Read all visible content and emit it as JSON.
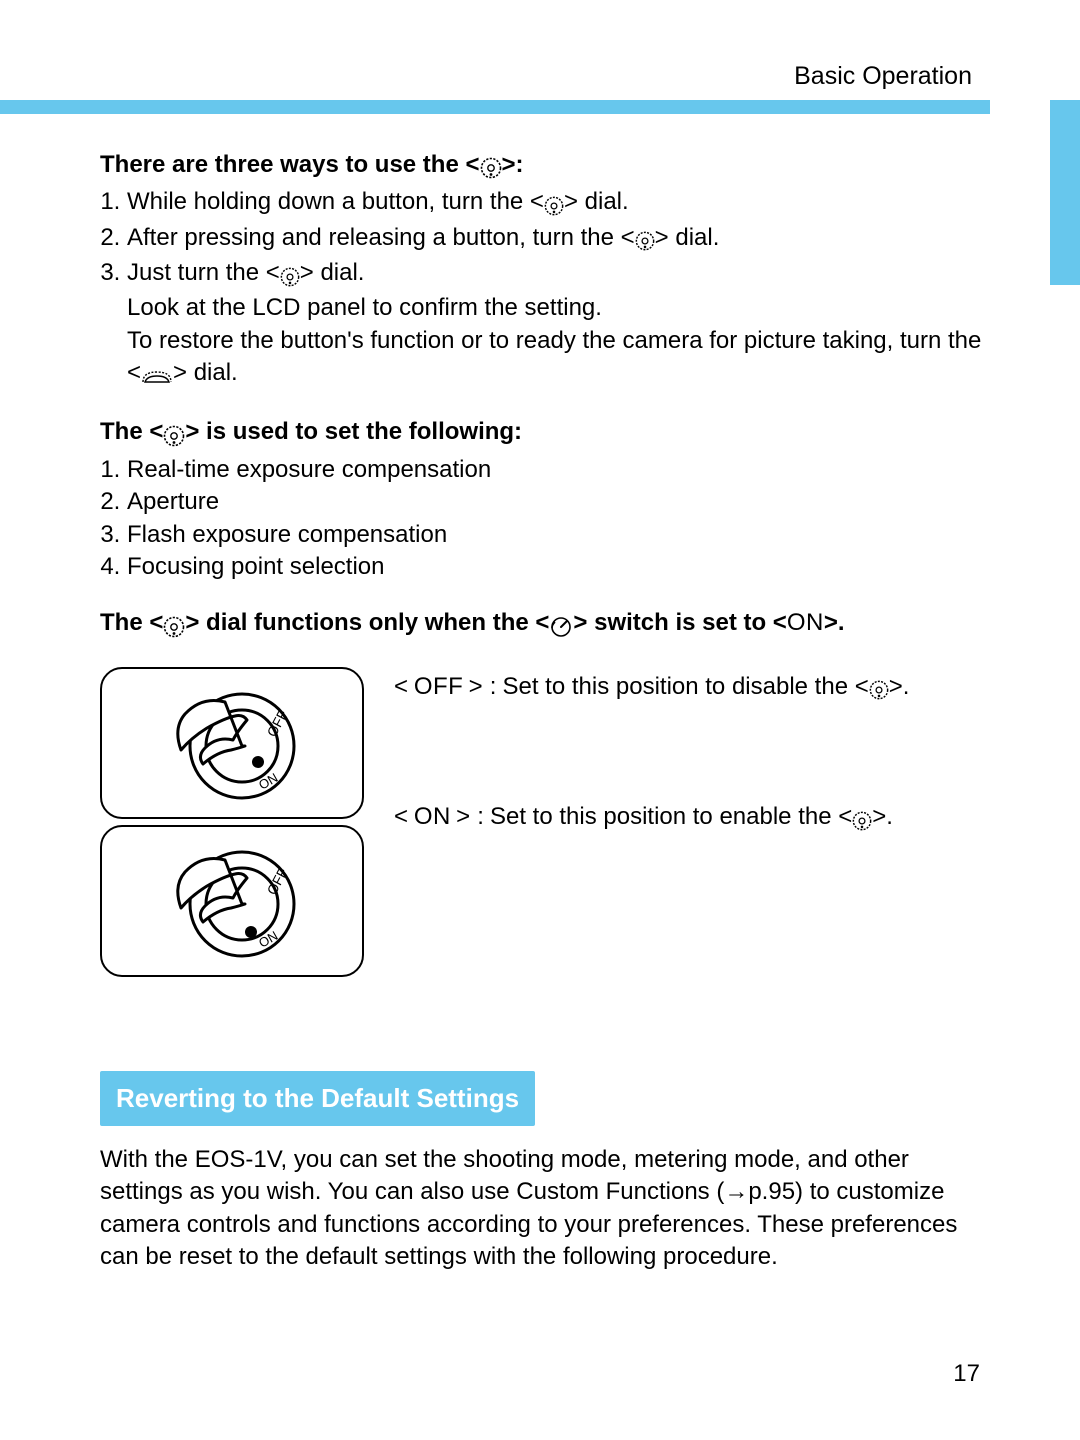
{
  "header": {
    "title": "Basic Operation"
  },
  "section1": {
    "heading_prefix": "There are three ways to use the <",
    "heading_suffix": ">:",
    "items": [
      {
        "prefix": "While holding down a button, turn the <",
        "suffix": "> dial."
      },
      {
        "prefix": "After pressing and releasing a button, turn the <",
        "suffix": "> dial."
      },
      {
        "prefix": "Just turn the <",
        "suffix": "> dial."
      }
    ],
    "note1": "Look at the LCD panel to confirm the setting.",
    "note2_prefix": "To restore the button's function or to ready the camera for picture taking, turn the <",
    "note2_suffix": "> dial."
  },
  "section2": {
    "heading_prefix": "The <",
    "heading_suffix": "> is used to set the following:",
    "items": [
      "Real-time exposure compensation",
      "Aperture",
      "Flash exposure compensation",
      "Focusing point selection"
    ]
  },
  "section3": {
    "heading_p1": "The <",
    "heading_p2": "> dial functions only when the <",
    "heading_p3": "> switch is set to <",
    "heading_on": "ON",
    "heading_p4": ">."
  },
  "switch": {
    "off_label": "OFF",
    "on_label": "ON",
    "off_desc_label": "< OFF >",
    "on_desc_label": "< ON >",
    "colon": " : ",
    "off_text_prefix": "Set to this position to disable the <",
    "off_text_suffix": ">.",
    "on_text_prefix": "Set to this position to enable the <",
    "on_text_suffix": ">."
  },
  "revert": {
    "heading": "Reverting to the Default Settings",
    "body": "With the EOS-1V, you can set the shooting mode, metering mode, and other settings as you wish. You can also use Custom Functions (→p.95) to customize camera controls and functions according to your preferences. These preferences can be reset to the default settings with the following procedure."
  },
  "page_number": "17"
}
